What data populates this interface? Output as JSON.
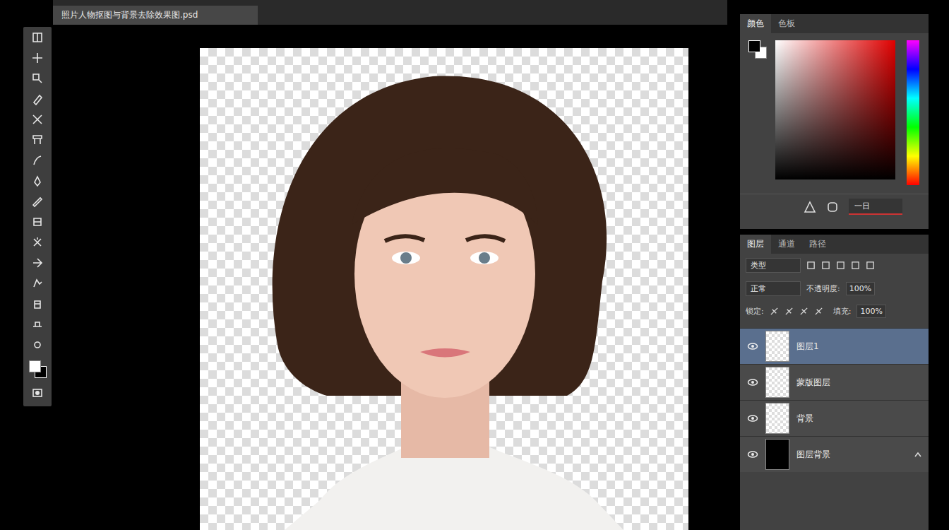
{
  "document_tab": {
    "title": "照片人物抠图与背景去除效果图.psd"
  },
  "color_panel": {
    "tabs": [
      {
        "label": "颜色",
        "selected": true
      },
      {
        "label": "色板",
        "selected": false
      }
    ],
    "reading": "一日"
  },
  "layers_panel": {
    "tabs": [
      {
        "label": "图层",
        "selected": true
      },
      {
        "label": "通道",
        "selected": false
      },
      {
        "label": "路径",
        "selected": false
      }
    ],
    "filter": "类型",
    "blend_mode": "正常",
    "opacity_label": "不透明度:",
    "opacity": "100%",
    "lock_label": "锁定:",
    "fill_label": "填充:",
    "fill": "100%",
    "layers": [
      {
        "name": "图层1",
        "visible": true,
        "selected": true,
        "kind": "transparent"
      },
      {
        "name": "蒙版图层",
        "visible": true,
        "selected": false,
        "kind": "transparent"
      },
      {
        "name": "背景",
        "visible": true,
        "selected": false,
        "kind": "transparent"
      },
      {
        "name": "图层背景",
        "visible": true,
        "selected": false,
        "kind": "solid"
      }
    ]
  }
}
